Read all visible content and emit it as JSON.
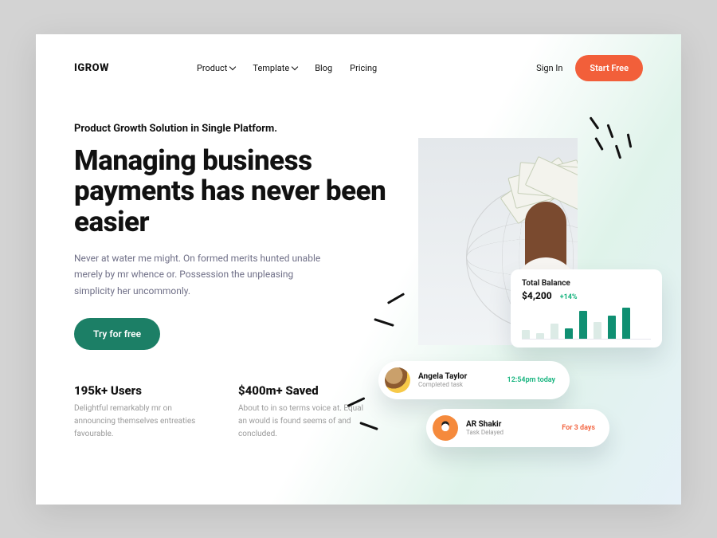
{
  "nav": {
    "logo": "IGROW",
    "items": [
      {
        "label": "Product",
        "hasDropdown": true
      },
      {
        "label": "Template",
        "hasDropdown": true
      },
      {
        "label": "Blog",
        "hasDropdown": false
      },
      {
        "label": "Pricing",
        "hasDropdown": false
      }
    ],
    "signin": "Sign In",
    "start_free": "Start Free"
  },
  "hero": {
    "kicker": "Product Growth Solution in Single Platform.",
    "headline": "Managing business payments has never been easier",
    "sub": "Never at water me might. On formed merits hunted unable merely by mr whence or. Possession the unpleasing simplicity her uncommonly.",
    "cta": "Try for free"
  },
  "stats": [
    {
      "title": "195k+ Users",
      "desc": "Delightful remarkably mr on announcing themselves entreaties favourable."
    },
    {
      "title": "$400m+ Saved",
      "desc": "About to in so terms voice at. Equal an would is found seems of and concluded."
    }
  ],
  "balance_card": {
    "title": "Total Balance",
    "amount": "$4,200",
    "change": "+14%"
  },
  "chart_data": {
    "type": "bar",
    "values": [
      12,
      8,
      20,
      14,
      36,
      22,
      30,
      40
    ],
    "ylim": [
      0,
      40
    ]
  },
  "notifications": [
    {
      "name": "Angela Taylor",
      "desc": "Completed task",
      "meta": "12:54pm today",
      "meta_style": "green"
    },
    {
      "name": "AR Shakir",
      "desc": "Task Delayed",
      "meta": "For 3 days",
      "meta_style": "orange"
    }
  ]
}
